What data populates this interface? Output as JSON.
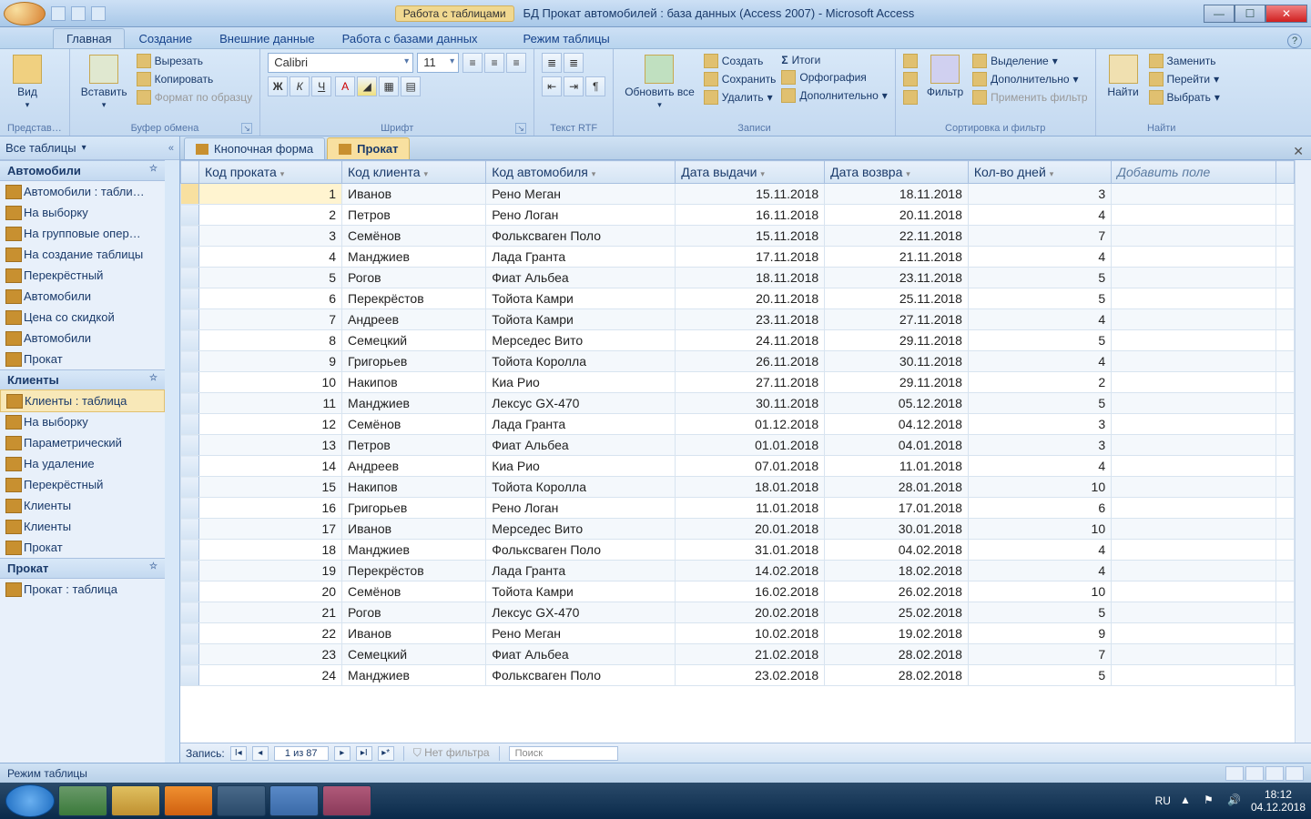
{
  "title": {
    "context_label": "Работа с таблицами",
    "app_title": "БД Прокат автомобилей : база данных (Access 2007) - Microsoft Access"
  },
  "ribbon_tabs": [
    "Главная",
    "Создание",
    "Внешние данные",
    "Работа с базами данных",
    "Режим таблицы"
  ],
  "ribbon": {
    "views": {
      "label": "Представ…",
      "btn": "Вид"
    },
    "clipboard": {
      "label": "Буфер обмена",
      "paste": "Вставить",
      "cut": "Вырезать",
      "copy": "Копировать",
      "fmt": "Формат по образцу"
    },
    "font": {
      "label": "Шрифт",
      "name": "Calibri",
      "size": "11"
    },
    "richtext": {
      "label": "Текст RTF"
    },
    "records": {
      "label": "Записи",
      "refresh": "Обновить все",
      "create": "Создать",
      "save": "Сохранить",
      "delete": "Удалить",
      "totals": "Итоги",
      "spell": "Орфография",
      "more": "Дополнительно"
    },
    "sort": {
      "label": "Сортировка и фильтр",
      "filter": "Фильтр",
      "selection": "Выделение",
      "advanced": "Дополнительно",
      "toggle": "Применить фильтр"
    },
    "find": {
      "label": "Найти",
      "find_btn": "Найти",
      "replace": "Заменить",
      "goto": "Перейти",
      "select": "Выбрать"
    }
  },
  "nav": {
    "header": "Все таблицы",
    "groups": [
      {
        "name": "Автомобили",
        "items": [
          "Автомобили : табли…",
          "На выборку",
          "На групповые опер…",
          "На создание таблицы",
          "Перекрёстный",
          "Автомобили",
          "Цена со скидкой",
          "Автомобили",
          "Прокат"
        ]
      },
      {
        "name": "Клиенты",
        "items": [
          "Клиенты : таблица",
          "На выборку",
          "Параметрический",
          "На удаление",
          "Перекрёстный",
          "Клиенты",
          "Клиенты",
          "Прокат"
        ],
        "selected": 0
      },
      {
        "name": "Прокат",
        "items": [
          "Прокат : таблица"
        ]
      }
    ]
  },
  "doc_tabs": [
    {
      "label": "Кнопочная форма"
    },
    {
      "label": "Прокат",
      "active": true
    }
  ],
  "columns": [
    "Код проката",
    "Код клиента",
    "Код автомобиля",
    "Дата выдачи",
    "Дата возвра",
    "Кол-во дней"
  ],
  "add_field": "Добавить поле",
  "rows": [
    [
      1,
      "Иванов",
      "Рено Меган",
      "15.11.2018",
      "18.11.2018",
      3
    ],
    [
      2,
      "Петров",
      "Рено Логан",
      "16.11.2018",
      "20.11.2018",
      4
    ],
    [
      3,
      "Семёнов",
      "Фольксваген Поло",
      "15.11.2018",
      "22.11.2018",
      7
    ],
    [
      4,
      "Манджиев",
      "Лада Гранта",
      "17.11.2018",
      "21.11.2018",
      4
    ],
    [
      5,
      "Рогов",
      "Фиат Альбеа",
      "18.11.2018",
      "23.11.2018",
      5
    ],
    [
      6,
      "Перекрёстов",
      "Тойота Камри",
      "20.11.2018",
      "25.11.2018",
      5
    ],
    [
      7,
      "Андреев",
      "Тойота Камри",
      "23.11.2018",
      "27.11.2018",
      4
    ],
    [
      8,
      "Семецкий",
      "Мерседес Вито",
      "24.11.2018",
      "29.11.2018",
      5
    ],
    [
      9,
      "Григорьев",
      "Тойота Королла",
      "26.11.2018",
      "30.11.2018",
      4
    ],
    [
      10,
      "Накипов",
      "Киа Рио",
      "27.11.2018",
      "29.11.2018",
      2
    ],
    [
      11,
      "Манджиев",
      "Лексус GX-470",
      "30.11.2018",
      "05.12.2018",
      5
    ],
    [
      12,
      "Семёнов",
      "Лада Гранта",
      "01.12.2018",
      "04.12.2018",
      3
    ],
    [
      13,
      "Петров",
      "Фиат Альбеа",
      "01.01.2018",
      "04.01.2018",
      3
    ],
    [
      14,
      "Андреев",
      "Киа Рио",
      "07.01.2018",
      "11.01.2018",
      4
    ],
    [
      15,
      "Накипов",
      "Тойота Королла",
      "18.01.2018",
      "28.01.2018",
      10
    ],
    [
      16,
      "Григорьев",
      "Рено Логан",
      "11.01.2018",
      "17.01.2018",
      6
    ],
    [
      17,
      "Иванов",
      "Мерседес Вито",
      "20.01.2018",
      "30.01.2018",
      10
    ],
    [
      18,
      "Манджиев",
      "Фольксваген Поло",
      "31.01.2018",
      "04.02.2018",
      4
    ],
    [
      19,
      "Перекрёстов",
      "Лада Гранта",
      "14.02.2018",
      "18.02.2018",
      4
    ],
    [
      20,
      "Семёнов",
      "Тойота Камри",
      "16.02.2018",
      "26.02.2018",
      10
    ],
    [
      21,
      "Рогов",
      "Лексус GX-470",
      "20.02.2018",
      "25.02.2018",
      5
    ],
    [
      22,
      "Иванов",
      "Рено Меган",
      "10.02.2018",
      "19.02.2018",
      9
    ],
    [
      23,
      "Семецкий",
      "Фиат Альбеа",
      "21.02.2018",
      "28.02.2018",
      7
    ],
    [
      24,
      "Манджиев",
      "Фольксваген Поло",
      "23.02.2018",
      "28.02.2018",
      5
    ]
  ],
  "recnav": {
    "label": "Запись:",
    "pos": "1 из 87",
    "nofilter": "Нет фильтра",
    "search": "Поиск"
  },
  "status": "Режим таблицы",
  "tray": {
    "lang": "RU",
    "time": "18:12",
    "date": "04.12.2018"
  }
}
